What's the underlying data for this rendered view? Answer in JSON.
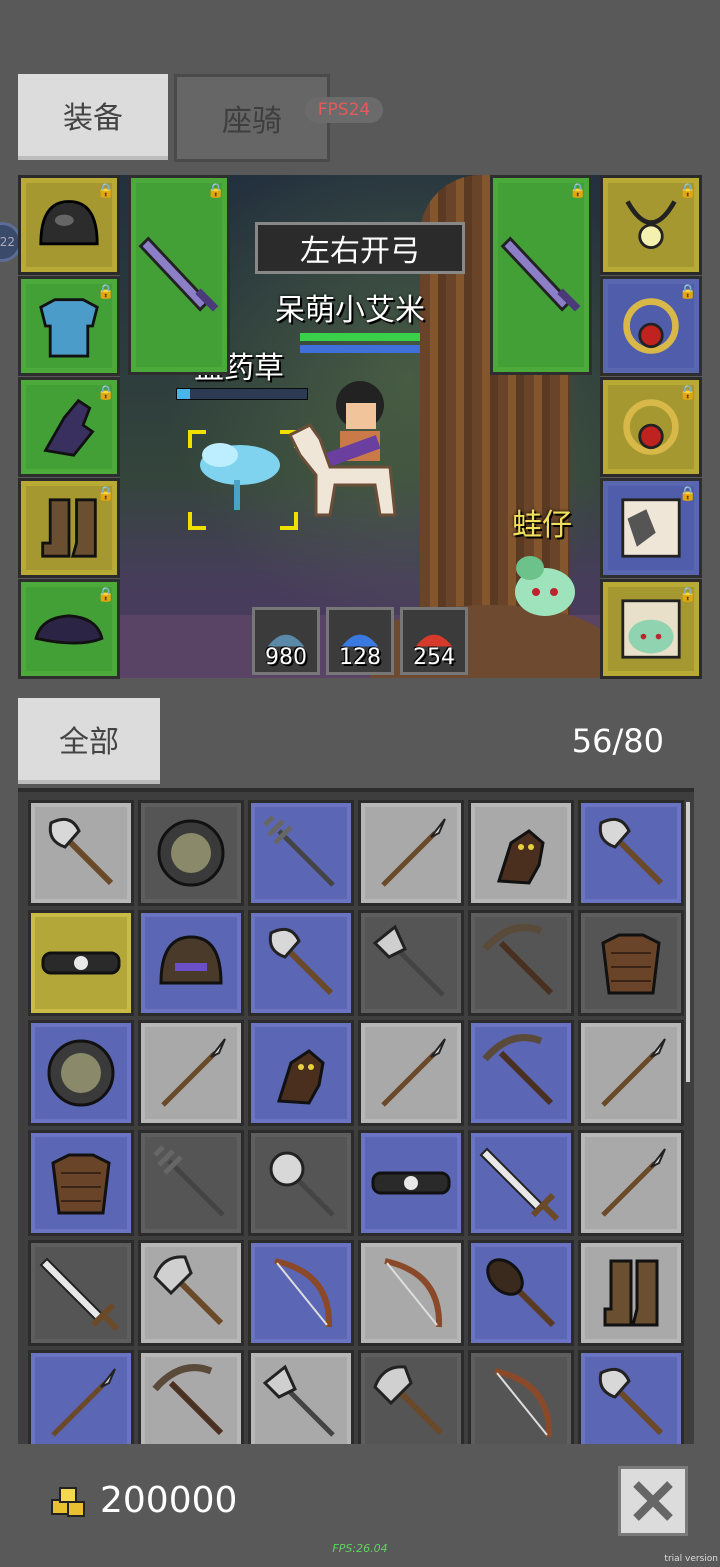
{
  "tabs": {
    "equip": "装备",
    "mount": "座骑"
  },
  "fps_badge": "FPS24",
  "left_indicator": "22",
  "scene": {
    "skill_name": "左右开弓",
    "player_name": "呆萌小艾米",
    "monster_name": "蓝药草",
    "pet_name": "蛙仔",
    "stats": [
      "980",
      "128",
      "254"
    ]
  },
  "equip_left": [
    "helmet-icon",
    "chest-armor-icon",
    "gloves-icon",
    "boots-icon",
    "hat-icon"
  ],
  "equip_weapons": [
    "sword-icon",
    "sword-icon"
  ],
  "equip_right": [
    "amulet-icon",
    "ring-icon",
    "ring-icon",
    "mount-portrait-icon",
    "pet-portrait-icon"
  ],
  "inventory": {
    "tab_all": "全部",
    "count": "56/80"
  },
  "items": [
    {
      "icon": "axe-icon",
      "rarity": "common"
    },
    {
      "icon": "shield-icon",
      "rarity": "dark"
    },
    {
      "icon": "trident-icon",
      "rarity": "blue"
    },
    {
      "icon": "spear-icon",
      "rarity": "common"
    },
    {
      "icon": "gloves-icon",
      "rarity": "common"
    },
    {
      "icon": "axe-icon",
      "rarity": "blue"
    },
    {
      "icon": "belt-icon",
      "rarity": "yellow"
    },
    {
      "icon": "helmet-icon",
      "rarity": "blue"
    },
    {
      "icon": "axe-icon",
      "rarity": "blue"
    },
    {
      "icon": "halberd-icon",
      "rarity": "dark"
    },
    {
      "icon": "pickaxe-icon",
      "rarity": "dark"
    },
    {
      "icon": "chest-armor-icon",
      "rarity": "dark"
    },
    {
      "icon": "shield-icon",
      "rarity": "blue"
    },
    {
      "icon": "spear-icon",
      "rarity": "common"
    },
    {
      "icon": "gloves-icon",
      "rarity": "blue"
    },
    {
      "icon": "spear-icon",
      "rarity": "common"
    },
    {
      "icon": "pickaxe-icon",
      "rarity": "blue"
    },
    {
      "icon": "spear-icon",
      "rarity": "common"
    },
    {
      "icon": "chest-armor-icon",
      "rarity": "blue"
    },
    {
      "icon": "trident-icon",
      "rarity": "dark"
    },
    {
      "icon": "mace-icon",
      "rarity": "dark"
    },
    {
      "icon": "belt-icon",
      "rarity": "blue"
    },
    {
      "icon": "sword-icon",
      "rarity": "blue"
    },
    {
      "icon": "spear-icon",
      "rarity": "common"
    },
    {
      "icon": "sword-icon",
      "rarity": "dark"
    },
    {
      "icon": "double-axe-icon",
      "rarity": "common"
    },
    {
      "icon": "bow-icon",
      "rarity": "blue"
    },
    {
      "icon": "bow-icon",
      "rarity": "common"
    },
    {
      "icon": "club-icon",
      "rarity": "blue"
    },
    {
      "icon": "boots-icon",
      "rarity": "common"
    },
    {
      "icon": "spear-icon",
      "rarity": "blue"
    },
    {
      "icon": "pickaxe-icon",
      "rarity": "common"
    },
    {
      "icon": "halberd-icon",
      "rarity": "common"
    },
    {
      "icon": "double-axe-icon",
      "rarity": "dark"
    },
    {
      "icon": "bow-icon",
      "rarity": "dark"
    },
    {
      "icon": "axe-icon",
      "rarity": "blue"
    }
  ],
  "gold": "200000",
  "fps_bottom": "FPS:26.04",
  "trial": "trial version"
}
